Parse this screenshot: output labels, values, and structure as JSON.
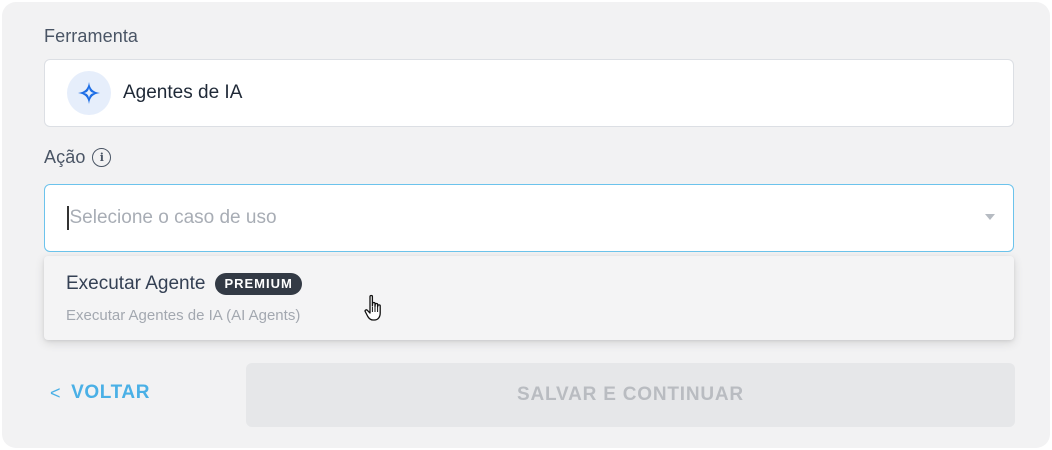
{
  "form": {
    "tool_label": "Ferramenta",
    "tool_icon": "sparkle-icon",
    "tool_value": "Agentes de IA",
    "action_label": "Ação",
    "action_info_icon": "info-icon",
    "action_placeholder": "Selecione o caso de uso",
    "accent_color": "#4ab0e6"
  },
  "dropdown": {
    "options": [
      {
        "title": "Executar Agente",
        "badge": "PREMIUM",
        "description": "Executar Agentes de IA (AI Agents)"
      }
    ]
  },
  "footer": {
    "back_label": "VOLTAR",
    "back_icon": "chevron-left-icon",
    "save_label": "SALVAR E CONTINUAR"
  }
}
